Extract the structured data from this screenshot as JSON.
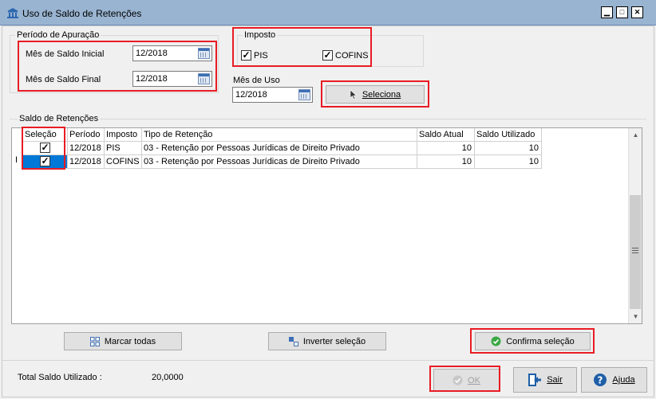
{
  "window": {
    "title": "Uso de Saldo de Retenções",
    "icon": "bank-icon"
  },
  "periodo": {
    "title": "Período de Apuração",
    "inicial_label": "Mês de Saldo Inicial",
    "inicial_value": "12/2018",
    "final_label": "Mês de Saldo Final",
    "final_value": "12/2018"
  },
  "imposto": {
    "title": "Imposto",
    "pis_label": "PIS",
    "pis_checked": true,
    "cofins_label": "COFINS",
    "cofins_checked": true
  },
  "mes_uso": {
    "label": "Mês de Uso",
    "value": "12/2018"
  },
  "seleciona_button": {
    "label": "Seleciona",
    "icon": "cursor-arrow-icon"
  },
  "saldo": {
    "title": "Saldo de Retenções",
    "columns": [
      "Seleção",
      "Período",
      "Imposto",
      "Tipo de Retenção",
      "Saldo Atual",
      "Saldo Utilizado"
    ],
    "rows": [
      {
        "selecao": true,
        "periodo": "12/2018",
        "imposto": "PIS",
        "tipo": "03 - Retenção por Pessoas Jurídicas de Direito Privado",
        "saldo_atual": "10",
        "saldo_utilizado": "10"
      },
      {
        "selecao": true,
        "periodo": "12/2018",
        "imposto": "COFINS",
        "tipo": "03 - Retenção por Pessoas Jurídicas de Direito Privado",
        "saldo_atual": "10",
        "saldo_utilizado": "10"
      }
    ],
    "cursor_glyph": "I"
  },
  "actions": {
    "marcar_todas": "Marcar todas",
    "inverter_selecao": "Inverter seleção",
    "confirma_selecao": "Confirma seleção"
  },
  "footer": {
    "total_label": "Total Saldo Utilizado :",
    "total_value": "20,0000",
    "ok_label": "OK",
    "sair_label": "Sair",
    "ajuda_label": "Ajuda"
  },
  "colors": {
    "highlight": "#e81c24",
    "titlebar": "#99b4d1",
    "selected_cell": "#0078d7",
    "confirm_icon": "#3aa845",
    "help_icon": "#1f5fa8"
  }
}
